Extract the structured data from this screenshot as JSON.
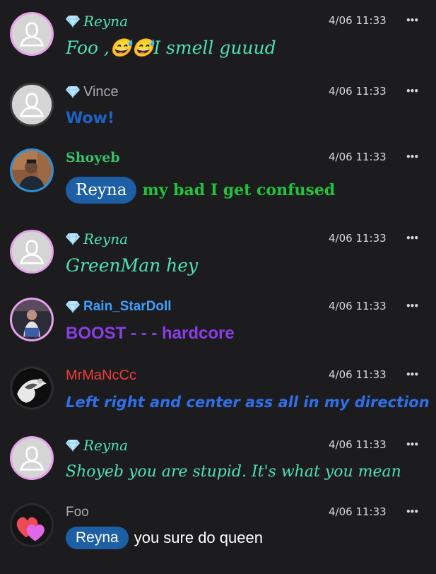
{
  "messages": [
    {
      "id": "m1",
      "name": "Reyna",
      "badge": true,
      "time": "4/06 11:33",
      "more": "•••",
      "text": "Foo ,😅😅I smell guuud",
      "mention": null,
      "avatar": "default-avatar-icon",
      "ring": "#e7a0ea",
      "nameColor": "#4fe0b0",
      "textColor": "#4fe0b0"
    },
    {
      "id": "m2",
      "name": "Vince",
      "badge": true,
      "time": "4/06 11:33",
      "more": "•••",
      "text": "Wow!",
      "mention": null,
      "avatar": "default-avatar-icon",
      "ring": "#3b3b3b",
      "nameColor": "#a9a9a9",
      "textColor": "#1d63c6"
    },
    {
      "id": "m3",
      "name": "Shoyeb",
      "badge": false,
      "time": "4/06 11:33",
      "more": "•••",
      "text": "my bad I get confused",
      "mention": "Reyna",
      "avatar": "user-photo-avatar",
      "ring": "#2d8fd5",
      "nameColor": "#35c46b",
      "textColor": "#22c33b"
    },
    {
      "id": "m4",
      "name": "Reyna",
      "badge": true,
      "time": "4/06 11:33",
      "more": "•••",
      "text": "GreenMan hey",
      "mention": null,
      "avatar": "default-avatar-icon",
      "ring": "#e7a0ea",
      "nameColor": "#4fe0b0",
      "textColor": "#4fe0b0"
    },
    {
      "id": "m5",
      "name": "Rain_StarDoll",
      "badge": true,
      "time": "4/06 11:33",
      "more": "•••",
      "text": "BOOST - - - hardcore",
      "mention": null,
      "avatar": "user-photo-avatar",
      "ring": "#e7a0ea",
      "nameColor": "#3fa0ff",
      "textColor": "#8a3ee6"
    },
    {
      "id": "m6",
      "name": "MrMaNcCc",
      "badge": false,
      "time": "4/06 11:33",
      "more": "•••",
      "text": "Left right and center ass all in my direction",
      "mention": null,
      "avatar": "user-photo-avatar",
      "ring": "#2a2a2a",
      "nameColor": "#ef3b3b",
      "textColor": "#2f6fe8"
    },
    {
      "id": "m7",
      "name": "Reyna",
      "badge": true,
      "time": "4/06 11:33",
      "more": "•••",
      "text": "Shoyeb you are stupid. It's what you mean",
      "mention": null,
      "avatar": "default-avatar-icon",
      "ring": "#e7a0ea",
      "nameColor": "#4fe0b0",
      "textColor": "#4fe0b0"
    },
    {
      "id": "m8",
      "name": "Foo",
      "badge": false,
      "time": "4/06 11:33",
      "more": "•••",
      "text": "you sure do queen",
      "mention": "Reyna",
      "avatar": "hearts-avatar-icon",
      "ring": "#2a2a2a",
      "nameColor": "#a9a9a9",
      "textColor": "#ffffff"
    }
  ]
}
